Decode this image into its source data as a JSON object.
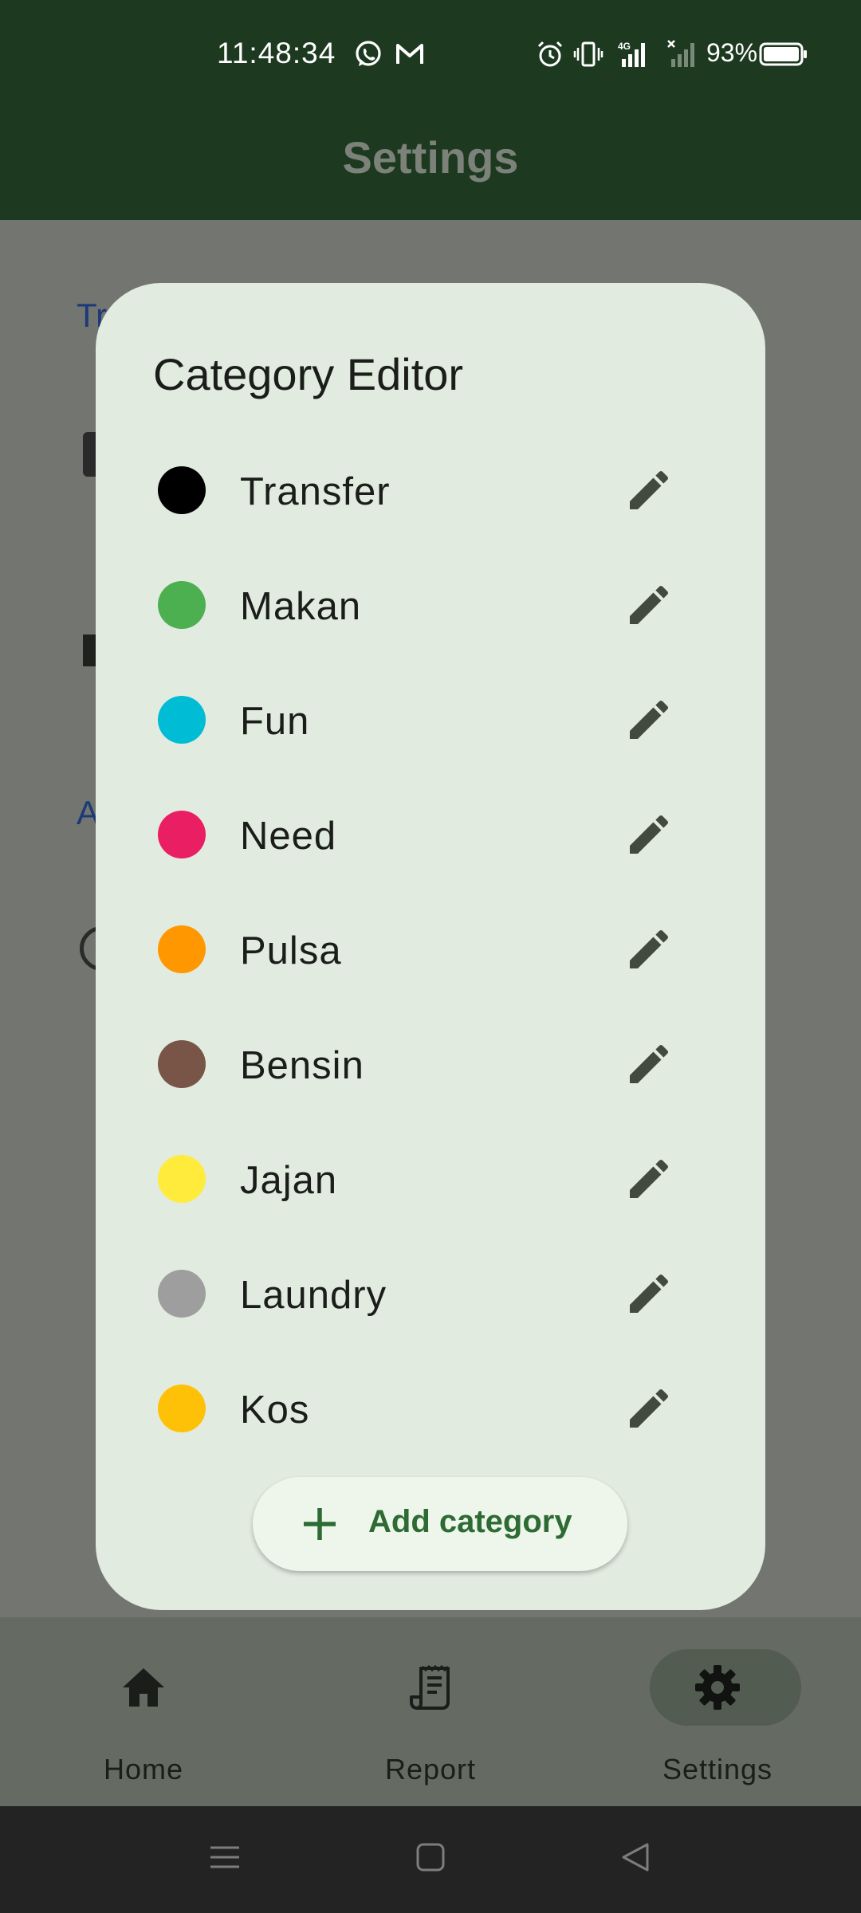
{
  "status_bar": {
    "time": "11:48:34",
    "battery": "93%",
    "icons": [
      "whatsapp-icon",
      "gmail-icon",
      "alarm-icon",
      "vibrate-icon",
      "signal-4g-icon",
      "signal-empty-icon",
      "battery-icon"
    ]
  },
  "app_bar": {
    "title": "Settings"
  },
  "background": {
    "fragment_1": "Tr",
    "fragment_2": "A"
  },
  "dialog": {
    "title": "Category Editor",
    "categories": [
      {
        "name": "Transfer",
        "color": "#000000"
      },
      {
        "name": "Makan",
        "color": "#4caf50"
      },
      {
        "name": "Fun",
        "color": "#00bcd4"
      },
      {
        "name": "Need",
        "color": "#e91e63"
      },
      {
        "name": "Pulsa",
        "color": "#ff9800"
      },
      {
        "name": "Bensin",
        "color": "#795548"
      },
      {
        "name": "Jajan",
        "color": "#ffeb3b"
      },
      {
        "name": "Laundry",
        "color": "#9e9e9e"
      },
      {
        "name": "Kos",
        "color": "#ffc107"
      }
    ],
    "add_button_label": "Add category"
  },
  "bottom_nav": {
    "items": [
      {
        "label": "Home",
        "icon": "home-icon",
        "active": false
      },
      {
        "label": "Report",
        "icon": "receipt-icon",
        "active": false
      },
      {
        "label": "Settings",
        "icon": "gear-icon",
        "active": true
      }
    ]
  },
  "system_nav": {
    "icons": [
      "menu-icon",
      "home-square-icon",
      "back-triangle-icon"
    ]
  },
  "colors": {
    "app_bar": "#1d3a21",
    "dialog_bg": "#e2ebe0",
    "accent": "#2e6b34",
    "edit_icon": "#424a40"
  }
}
